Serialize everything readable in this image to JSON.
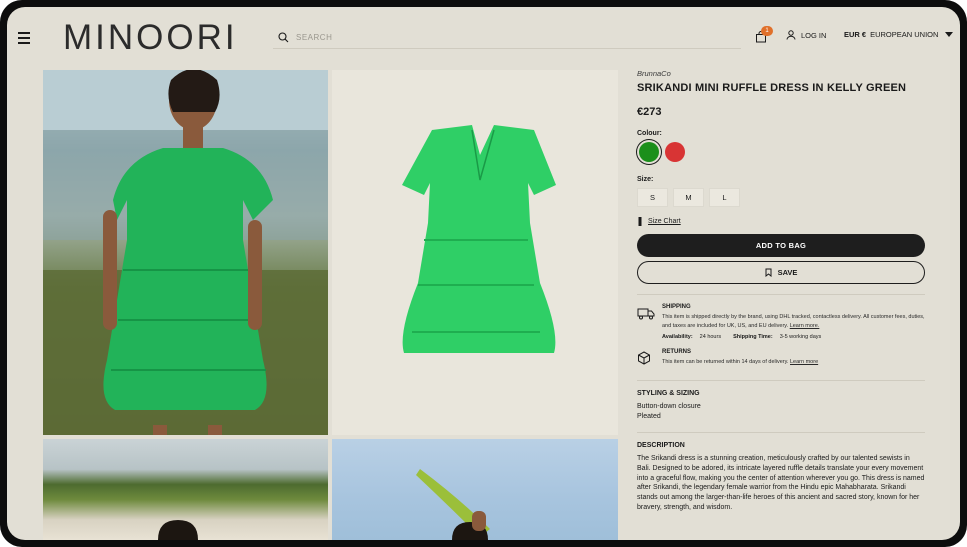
{
  "header": {
    "logo": "MINOORI",
    "search_placeholder": "SEARCH",
    "cart_count": "1",
    "login_label": "LOG IN",
    "currency": "EUR €",
    "region": "EUROPEAN UNION"
  },
  "product": {
    "brand": "BrunnaCo",
    "title": "SRIKANDI MINI RUFFLE DRESS IN KELLY GREEN",
    "price": "€273",
    "colour_label": "Colour:",
    "colours": [
      "#1b8f1b",
      "#d83434"
    ],
    "size_label": "Size:",
    "sizes": [
      "S",
      "M",
      "L"
    ],
    "size_chart": "Size Chart",
    "add_to_bag": "ADD TO BAG",
    "save": "SAVE"
  },
  "shipping": {
    "title": "SHIPPING",
    "text": "This item is shipped directly by the brand, using DHL tracked, contactless delivery. All customer fees, duties, and taxes are included for UK, US, and EU delivery.",
    "learn_more": "Learn more.",
    "availability_label": "Availability:",
    "availability_value": "24 hours",
    "shipping_time_label": "Shipping Time:",
    "shipping_time_value": "3-5 working days"
  },
  "returns": {
    "title": "RETURNS",
    "text": "This item can be returned within 14 days of delivery.",
    "learn_more": "Learn more"
  },
  "styling": {
    "title": "STYLING & SIZING",
    "items": [
      "Button-down closure",
      "Pleated"
    ]
  },
  "description": {
    "title": "DESCRIPTION",
    "text": "The Srikandi dress is a stunning creation, meticulously crafted by our talented sewists in Bali. Designed to be adored, its intricate layered ruffle details translate your every movement into a graceful flow, making you the center of attention wherever you go. This dress is named after Srikandi, the legendary female warrior from the Hindu epic Mahabharata. Srikandi stands out among the larger-than-life heroes of this ancient and sacred story, known for her bravery, strength, and wisdom."
  }
}
